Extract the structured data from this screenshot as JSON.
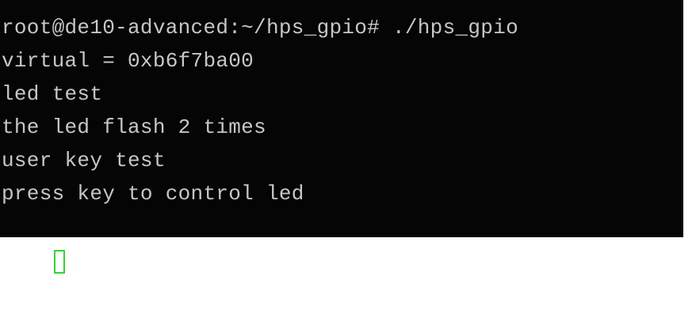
{
  "terminal": {
    "lines": [
      "root@de10-advanced:~/hps_gpio# ./hps_gpio",
      "virtual = 0xb6f7ba00",
      "led test",
      "the led flash 2 times",
      "user key test",
      "press key to control led"
    ],
    "cursor_color": "#2fd62f",
    "background_color": "#050505",
    "text_color": "#c7c7c7"
  }
}
